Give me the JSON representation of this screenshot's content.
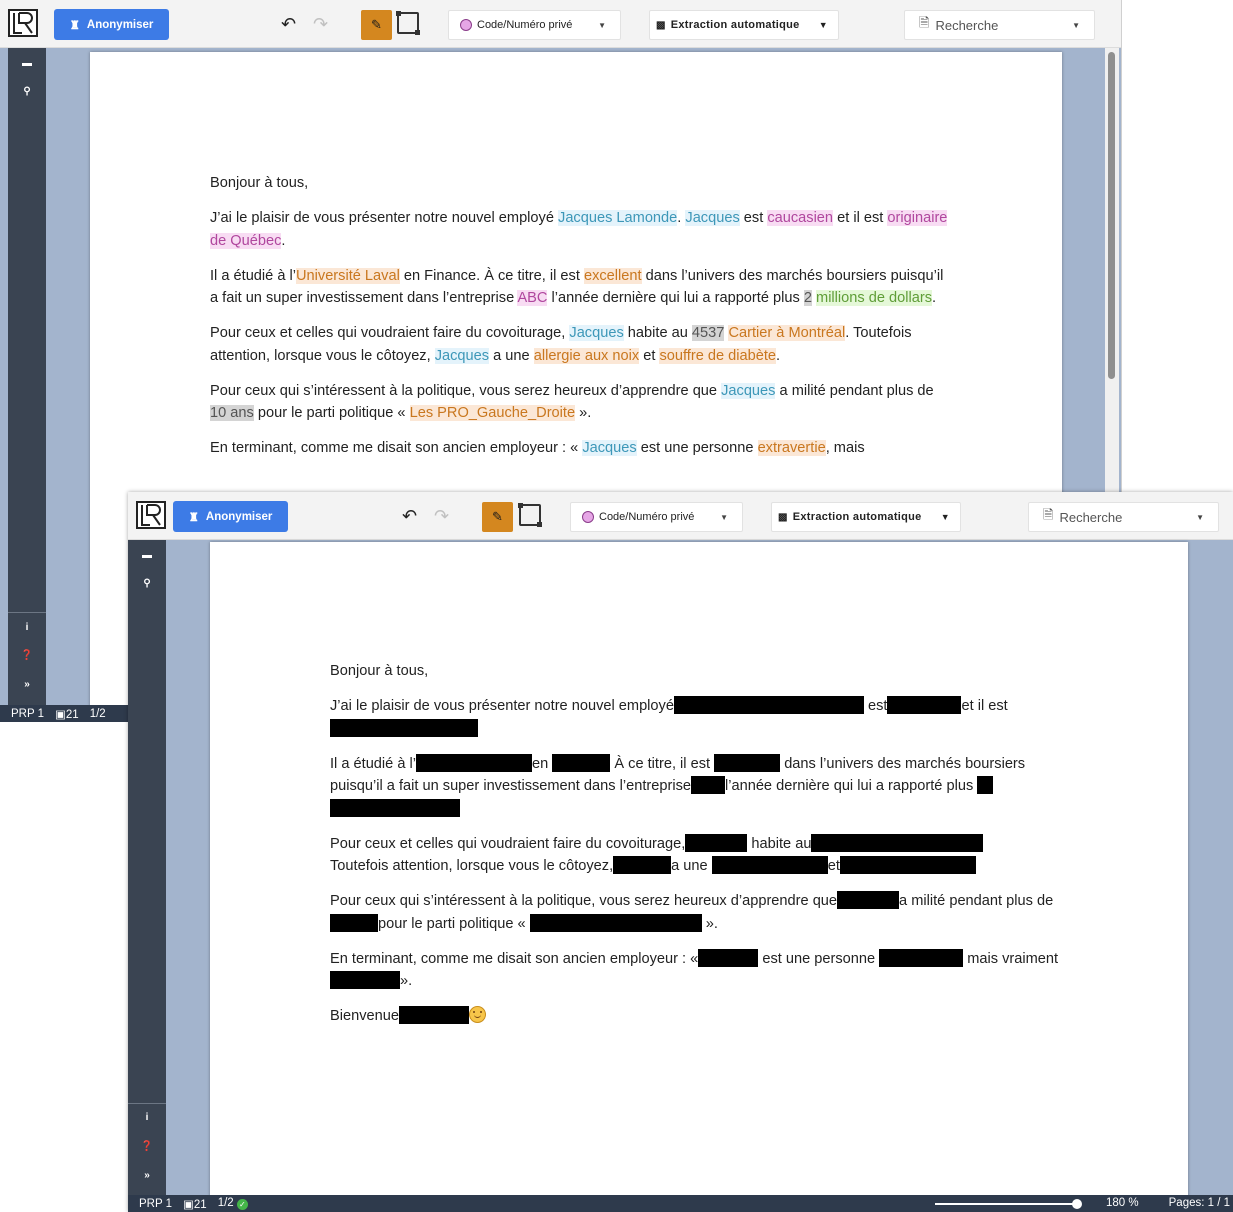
{
  "toolbar": {
    "anonymize_label": "Anonymiser",
    "category_dropdown": "Code/Numéro privé",
    "extraction_dropdown": "Extraction automatique",
    "search_placeholder": "Recherche"
  },
  "status": {
    "prp": "PRP 1",
    "count": "21",
    "fraction": "1/2",
    "zoom": "180 %",
    "pages": "Pages: 1 / 1"
  },
  "doc": {
    "greeting": "Bonjour à tous,",
    "p1": {
      "a": "J’ai le plaisir de vous présenter notre nouvel employé ",
      "name": "Jacques Lamonde",
      "b": ". ",
      "first": "Jacques",
      "c": " est ",
      "ethnicity": "caucasien",
      "d": " et il est ",
      "origin": "originaire de Québec",
      "e": "."
    },
    "p2": {
      "a": "Il a étudié à l’",
      "school": "Université Laval",
      "b": " en Finance. À ce titre, il est ",
      "trait": "excellent",
      "c": " dans l’univers des marchés boursiers puisqu’il a fait un super investissement dans l’entreprise ",
      "company": "ABC",
      "d": " l’année dernière qui lui a rapporté plus ",
      "num": "2",
      "amount": "millions de dollars",
      "e": "."
    },
    "p3": {
      "a": "Pour ceux et celles qui voudraient faire du covoiturage, ",
      "name": "Jacques",
      "b": " habite au ",
      "civic": "4537",
      "street": "Cartier à Montréal",
      "c": ". Toutefois attention, lorsque vous le côtoyez, ",
      "name2": "Jacques",
      "d": " a une ",
      "allergy": "allergie aux noix",
      "e": " et ",
      "disease": "souffre de diabète",
      "f": "."
    },
    "p4": {
      "a": "Pour ceux qui s’intéressent à la politique, vous serez heureux d’apprendre que ",
      "name": "Jacques",
      "b": " a milité pendant plus de ",
      "years": "10 ans",
      "c": " pour le parti politique « ",
      "party": "Les PRO_Gauche_Droite",
      "d": " »."
    },
    "p5": {
      "a": "En terminant, comme me disait son ancien employeur : « ",
      "name": "Jacques",
      "b": " est une personne ",
      "trait": "extravertie",
      "c": ", mais"
    }
  },
  "redacted": {
    "greeting": "Bonjour à tous,",
    "p1a": "J’ai le plaisir de vous présenter notre nouvel employé",
    "p1b": "est",
    "p1c": "et il est",
    "p2a": "Il a étudié à l’",
    "p2b": "en",
    "p2c": "À ce titre, il est",
    "p2d": "dans l’univers des marchés boursiers puisqu’il a fait un super investissement dans l’entreprise",
    "p2e": "l’année dernière qui lui a rapporté plus",
    "p3a": "Pour ceux et celles qui voudraient faire du covoiturage,",
    "p3b": "habite au",
    "p3c": "Toutefois attention, lorsque vous le côtoyez,",
    "p3d": "a une",
    "p3e": "et",
    "p4a": "Pour ceux qui s’intéressent à la politique, vous serez heureux d’apprendre que",
    "p4b": "a milité pendant plus de",
    "p4c": "pour le parti politique «",
    "p4d": "».",
    "p5a": "En terminant, comme me disait son ancien employeur : «",
    "p5b": "est une personne",
    "p5c": "mais vraiment",
    "p5d": "».",
    "p6a": "Bienvenue"
  },
  "colors": {
    "accent": "#3d7be6",
    "active_tool": "#d4871f",
    "sidebar": "#3a4452",
    "statusbar": "#2e3a4c"
  }
}
